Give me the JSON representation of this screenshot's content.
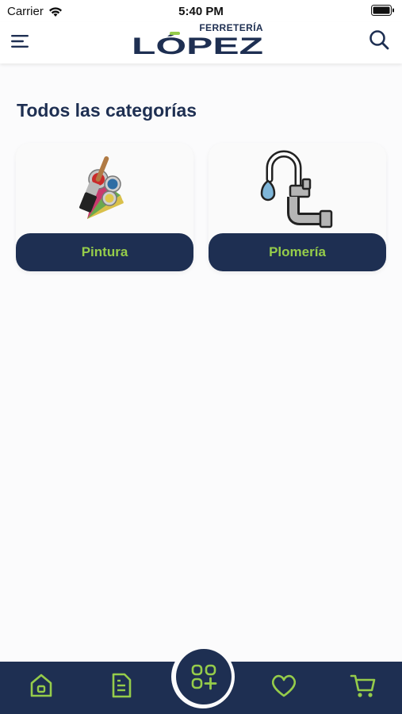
{
  "status_bar": {
    "carrier": "Carrier",
    "time": "5:40 PM"
  },
  "header": {
    "logo_sub": "FERRETERÍA",
    "logo_main": "LÓPEZ"
  },
  "main": {
    "title": "Todos las categorías",
    "categories": [
      {
        "label": "Pintura",
        "icon": "paint-palette-icon"
      },
      {
        "label": "Plomería",
        "icon": "faucet-pipe-icon"
      }
    ]
  },
  "bottom_nav": {
    "items": [
      "home-icon",
      "document-icon",
      "categories-icon",
      "heart-icon",
      "cart-icon"
    ]
  },
  "colors": {
    "navy": "#1e2f52",
    "accent": "#95cc4a",
    "background": "#fbfbfc"
  }
}
